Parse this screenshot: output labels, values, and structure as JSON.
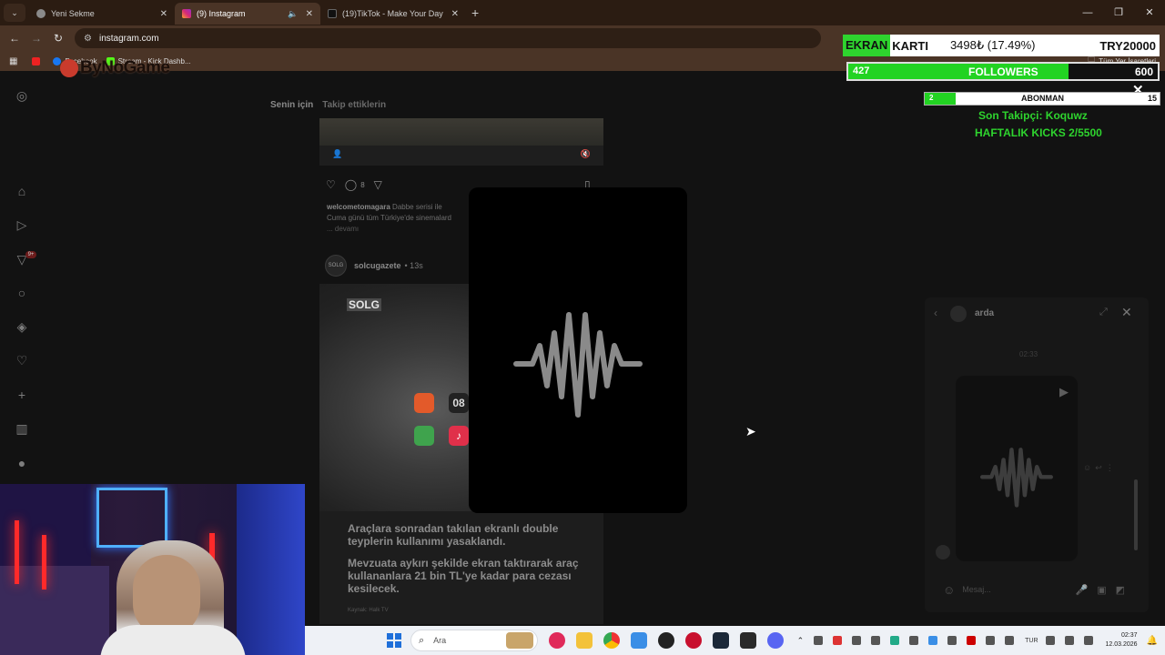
{
  "browser": {
    "tabs": [
      {
        "label": "Yeni Sekme",
        "color": "#8a8a8a"
      },
      {
        "label": "(9) Instagram",
        "color": "#d62976"
      },
      {
        "label": "(19)TikTok - Make Your Day",
        "color": "#111111"
      }
    ],
    "url": "instagram.com",
    "bookmarks": [
      "Facebook",
      "Stream - Kick Dashb..."
    ],
    "bookmarks_right": "Tüm Yer İşaretleri",
    "overlay_logo": "ByNoGame"
  },
  "instagram": {
    "feed_tabs": [
      "Senin için",
      "Takip ettiklerin"
    ],
    "notification_badge": "9+",
    "post1": {
      "comment_count": "8",
      "username": "welcometomagara",
      "caption": "Dabbe serisi ile",
      "caption_line2": "Cuma günü tüm Türkiye'de sinemalard",
      "more": "... devamı"
    },
    "post2": {
      "avatar_text": "SOLG",
      "username": "solcugazete",
      "age": "• 13s",
      "tag": "SOLG",
      "screen_number": "08",
      "headline": "Araçlara sonradan takılan ekranlı double teyplerin kullanımı yasaklandı.",
      "subline": "Mevzuata aykırı şekilde ekran taktırarak araç kullananlara 21 bin TL'ye kadar para cezası kesilecek.",
      "source": "Kaynak: Halk TV"
    }
  },
  "dm": {
    "name": "arda",
    "time": "02:33",
    "placeholder": "Mesaj..."
  },
  "overlay": {
    "card_label_green": "EKRAN",
    "card_label_white": " KARTI",
    "card_value": "3498₺ (17.49%)",
    "card_goal": "TRY20000",
    "followers_current": "427",
    "followers_label": "FOLLOWERS",
    "followers_goal": "600",
    "followers_progress": 0.7117,
    "subs_current": "2",
    "subs_label": "ABONMAN",
    "subs_goal": "15",
    "subs_progress": 0.1333,
    "last_follower": "Son Takipçi: Koquwz",
    "weekly_kicks": "HAFTALIK KICKS 2/5500",
    "accent": "#2ed42e"
  },
  "taskbar": {
    "search": "Ara",
    "lang": "TUR",
    "time": "02:37",
    "date": "12.03.2026"
  }
}
